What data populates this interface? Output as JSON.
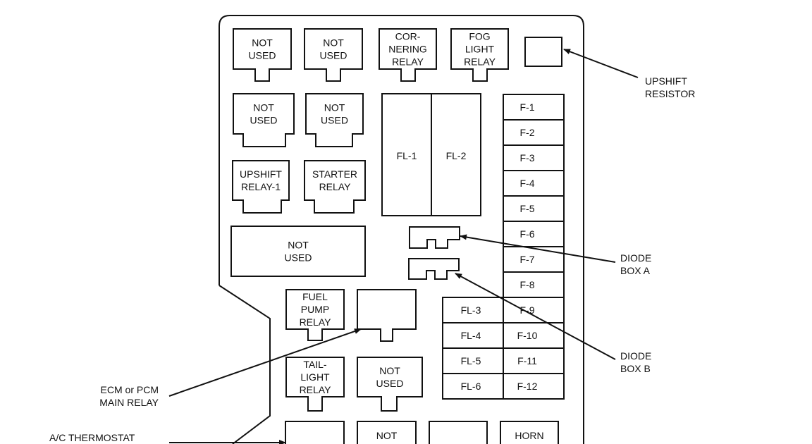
{
  "relays": [
    {
      "lines": [
        "NOT",
        "USED"
      ]
    },
    {
      "lines": [
        "NOT",
        "USED"
      ]
    },
    {
      "lines": [
        "COR-",
        "NERING",
        "RELAY"
      ]
    },
    {
      "lines": [
        "FOG",
        "LIGHT",
        "RELAY"
      ]
    },
    {
      "lines": [
        "NOT",
        "USED"
      ]
    },
    {
      "lines": [
        "NOT",
        "USED"
      ]
    },
    {
      "lines": [
        "UPSHIFT",
        "RELAY-1"
      ]
    },
    {
      "lines": [
        "STARTER",
        "RELAY"
      ]
    },
    {
      "lines": [
        "NOT",
        "USED"
      ]
    },
    {
      "lines": [
        "FUEL",
        "PUMP",
        "RELAY"
      ]
    },
    {
      "lines": []
    },
    {
      "lines": [
        "TAIL-",
        "LIGHT",
        "RELAY"
      ]
    },
    {
      "lines": [
        "NOT",
        "USED"
      ]
    },
    {
      "lines": []
    },
    {
      "lines": [
        "NOT"
      ]
    },
    {
      "lines": []
    },
    {
      "lines": [
        "HORN"
      ]
    }
  ],
  "fusible_links_large": [
    "FL-1",
    "FL-2"
  ],
  "fuses": [
    "F-1",
    "F-2",
    "F-3",
    "F-4",
    "F-5",
    "F-6",
    "F-7",
    "F-8",
    "F-9",
    "F-10",
    "F-11",
    "F-12"
  ],
  "fusible_links_small": [
    "FL-3",
    "FL-4",
    "FL-5",
    "FL-6"
  ],
  "callouts": [
    {
      "lines": [
        "UPSHIFT",
        "RESISTOR"
      ]
    },
    {
      "lines": [
        "DIODE",
        "BOX A"
      ]
    },
    {
      "lines": [
        "DIODE",
        "BOX B"
      ]
    },
    {
      "lines": [
        "ECM or PCM",
        "MAIN RELAY"
      ]
    },
    {
      "lines": [
        "A/C THERMOSTAT"
      ]
    }
  ]
}
